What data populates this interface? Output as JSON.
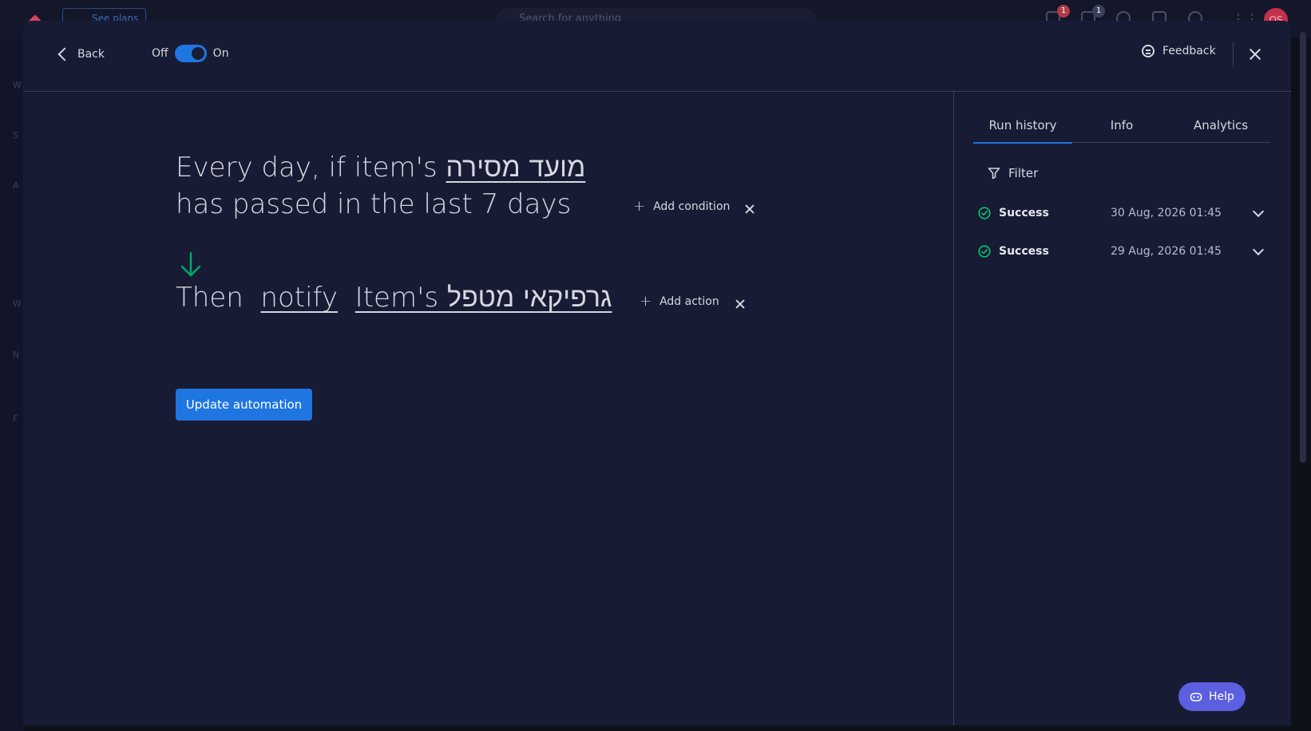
{
  "background": {
    "plans_label": "See plans",
    "search_placeholder": "Search for anything",
    "notif_count": "1",
    "inbox_count": "1",
    "avatar_initials": "OS"
  },
  "header": {
    "back_label": "Back",
    "toggle_off_label": "Off",
    "toggle_on_label": "On",
    "toggle_state": "on",
    "feedback_label": "Feedback"
  },
  "automation": {
    "trigger_prefix": "Every day, if item's",
    "trigger_column": "מועד מסירה",
    "trigger_suffix": "has passed in the last 7 days",
    "add_condition_label": "Add condition",
    "action_prefix": "Then",
    "action_verb": "notify",
    "action_target": "Item's גרפיקאי מטפל",
    "add_action_label": "Add action",
    "update_button_label": "Update automation"
  },
  "side_panel": {
    "tabs": [
      {
        "label": "Run history",
        "active": true
      },
      {
        "label": "Info",
        "active": false
      },
      {
        "label": "Analytics",
        "active": false
      }
    ],
    "filter_label": "Filter",
    "runs": [
      {
        "status": "Success",
        "time": "30 Aug, 2026 01:45"
      },
      {
        "status": "Success",
        "time": "29 Aug, 2026 01:45"
      }
    ]
  },
  "help_label": "Help",
  "colors": {
    "accent": "#1f76e0",
    "success": "#00c875",
    "arrow": "#00a86b",
    "help": "#5b5fe0",
    "modal_bg": "#181b34"
  }
}
